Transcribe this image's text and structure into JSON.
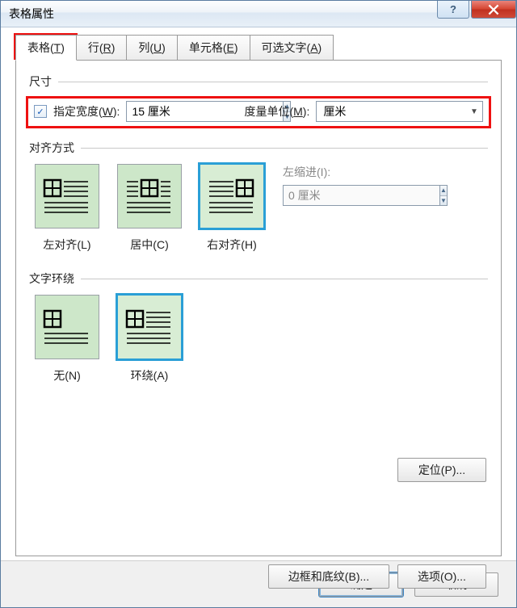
{
  "title": "表格属性",
  "tabs": {
    "table": "表格(T)",
    "row": "行(R)",
    "col": "列(U)",
    "cell": "单元格(E)",
    "alt": "可选文字(A)"
  },
  "size": {
    "group_label": "尺寸",
    "width_checkbox_checked": true,
    "width_label": "指定宽度(W):",
    "width_value": "15 厘米",
    "unit_label": "度量单位(M):",
    "unit_value": "厘米"
  },
  "alignment": {
    "group_label": "对齐方式",
    "left": "左对齐(L)",
    "center": "居中(C)",
    "right": "右对齐(H)",
    "indent_label": "左缩进(I):",
    "indent_value": "0 厘米",
    "selected": "right"
  },
  "wrap": {
    "group_label": "文字环绕",
    "none": "无(N)",
    "around": "环绕(A)",
    "selected": "around"
  },
  "buttons": {
    "positioning": "定位(P)...",
    "borders": "边框和底纹(B)...",
    "options": "选项(O)...",
    "ok": "确定",
    "cancel": "取消"
  }
}
